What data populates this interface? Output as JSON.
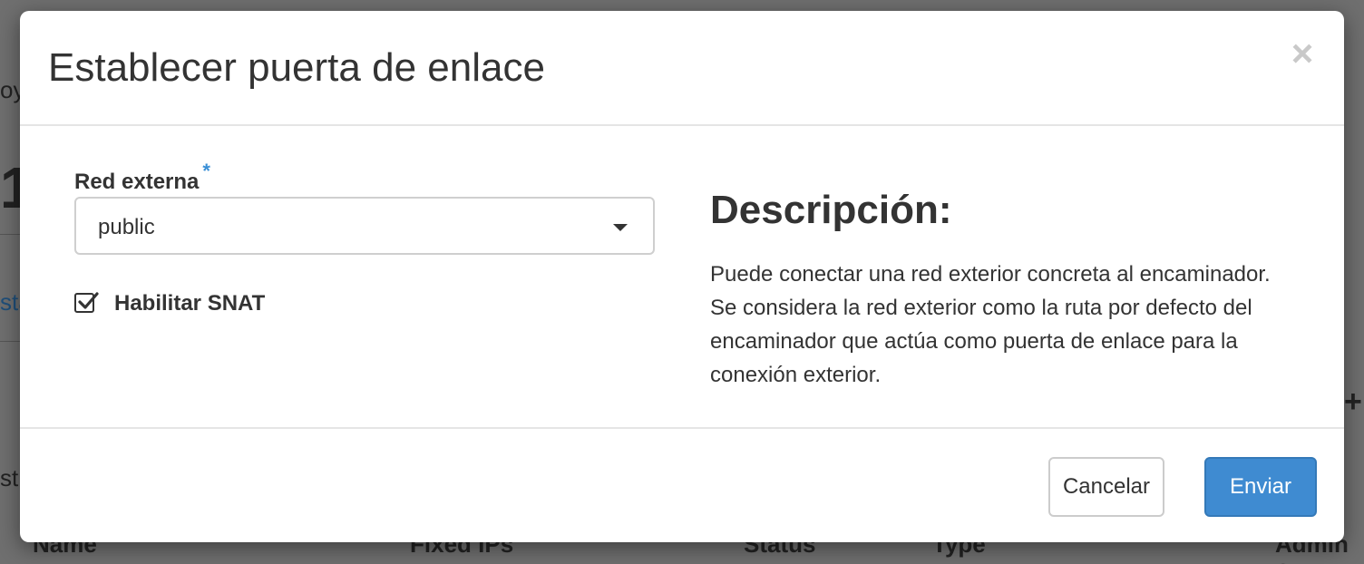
{
  "background": {
    "fragment_1": "oy",
    "fragment_2": "1",
    "fragment_3": "sta",
    "fragment_4": "str",
    "plus_icon": "plus-icon",
    "table_headers": [
      "Name",
      "Fixed IPs",
      "Status",
      "Type",
      "Admin S"
    ]
  },
  "modal": {
    "title": "Establecer puerta de enlace",
    "close_icon": "close-icon",
    "form": {
      "external_network_label": "Red externa",
      "required_marker": "*",
      "external_network_value": "public",
      "snat_label": "Habilitar SNAT",
      "snat_checked": true
    },
    "description": {
      "title": "Descripción:",
      "text": "Puede conectar una red exterior concreta al encaminador. Se considera la red exterior como la ruta por defecto del encaminador que actúa como puerta de enlace para la conexión exterior."
    },
    "footer": {
      "cancel_label": "Cancelar",
      "submit_label": "Enviar"
    }
  },
  "colors": {
    "primary": "#3f8bd1",
    "required": "#3a8fd6",
    "overlay": "#6f6f6f"
  }
}
